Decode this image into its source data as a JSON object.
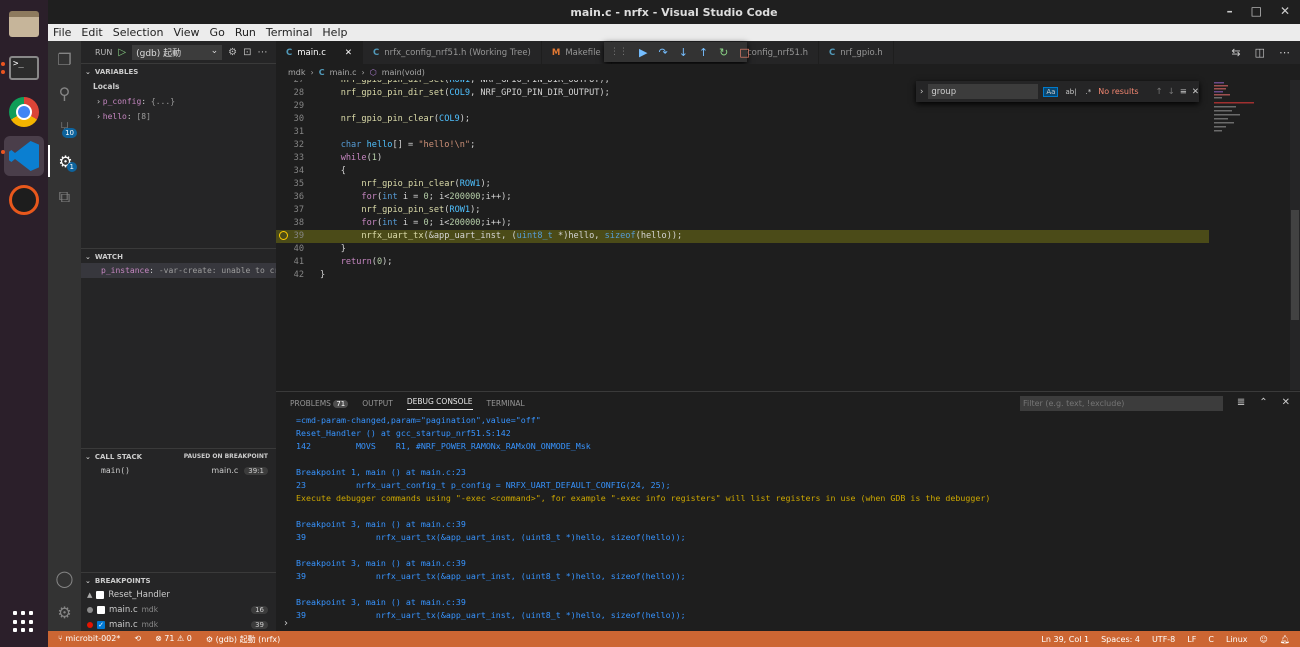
{
  "window": {
    "title": "main.c - nrfx - Visual Studio Code"
  },
  "menu": [
    "File",
    "Edit",
    "Selection",
    "View",
    "Go",
    "Run",
    "Terminal",
    "Help"
  ],
  "dock": {
    "term_glyph": ">_"
  },
  "activity_badges": {
    "scm": "10",
    "debug": "1"
  },
  "sidebar": {
    "run_label": "RUN",
    "config": "(gdb) 起動",
    "variables_title": "VARIABLES",
    "locals_label": "Locals",
    "variables": [
      {
        "name": "p_config",
        "value": "{...}"
      },
      {
        "name": "hello",
        "value": "[8]"
      }
    ],
    "watch_title": "WATCH",
    "watch": [
      {
        "name": "p_instance",
        "value": "-var-create: unable to cre..."
      }
    ],
    "callstack_title": "CALL STACK",
    "callstack_status": "PAUSED ON BREAKPOINT",
    "callstack": [
      {
        "name": "main()",
        "file": "main.c",
        "pos": "39:1"
      }
    ],
    "breakpoints_title": "BREAKPOINTS",
    "breakpoints": [
      {
        "name": "Reset_Handler",
        "folder": "",
        "line": ""
      },
      {
        "name": "main.c",
        "folder": "mdk",
        "line": "16"
      },
      {
        "name": "main.c",
        "folder": "mdk",
        "line": "39"
      }
    ]
  },
  "tabs": [
    {
      "icon": "C",
      "label": "main.c"
    },
    {
      "icon": "C",
      "label": "nrfx_config_nrf51.h (Working Tree)"
    },
    {
      "icon": "M",
      "label": "Makefile"
    },
    {
      "icon": "",
      "label": "x_config_nrf51.h"
    },
    {
      "icon": "C",
      "label": "nrf_gpio.h"
    }
  ],
  "breadcrumb": {
    "folder": "mdk",
    "file": "main.c",
    "symbol": "main(void)"
  },
  "find": {
    "value": "group",
    "case_opt": "Aa",
    "word_opt": "ab|",
    "regex_opt": ".*",
    "status": "No results"
  },
  "code": {
    "lines": [
      "27",
      "28",
      "29",
      "30",
      "31",
      "32",
      "33",
      "34",
      "35",
      "36",
      "37",
      "38",
      "39",
      "40",
      "41",
      "42"
    ]
  },
  "panel": {
    "tabs": [
      "PROBLEMS",
      "OUTPUT",
      "DEBUG CONSOLE",
      "TERMINAL"
    ],
    "problems_count": "71",
    "filter_placeholder": "Filter (e.g. text, !exclude)",
    "console": [
      {
        "text": "=cmd-param-changed,param=\"pagination\",value=\"off\"",
        "color": "blue"
      },
      {
        "text": "Reset_Handler () at gcc_startup_nrf51.S:142",
        "color": "blue"
      },
      {
        "text": "142         MOVS    R1, #NRF_POWER_RAMONx_RAMxON_ONMODE_Msk",
        "color": "blue"
      },
      {
        "text": "",
        "color": "blue"
      },
      {
        "text": "Breakpoint 1, main () at main.c:23",
        "color": "blue"
      },
      {
        "text": "23          nrfx_uart_config_t p_config = NRFX_UART_DEFAULT_CONFIG(24, 25);",
        "color": "blue"
      },
      {
        "text": "Execute debugger commands using \"-exec <command>\", for example \"-exec info registers\" will list registers in use (when GDB is the debugger)",
        "color": "orange"
      },
      {
        "text": "",
        "color": "blue"
      },
      {
        "text": "Breakpoint 3, main () at main.c:39",
        "color": "blue"
      },
      {
        "text": "39              nrfx_uart_tx(&app_uart_inst, (uint8_t *)hello, sizeof(hello));",
        "color": "blue"
      },
      {
        "text": "",
        "color": "blue"
      },
      {
        "text": "Breakpoint 3, main () at main.c:39",
        "color": "blue"
      },
      {
        "text": "39              nrfx_uart_tx(&app_uart_inst, (uint8_t *)hello, sizeof(hello));",
        "color": "blue"
      },
      {
        "text": "",
        "color": "blue"
      },
      {
        "text": "Breakpoint 3, main () at main.c:39",
        "color": "blue"
      },
      {
        "text": "39              nrfx_uart_tx(&app_uart_inst, (uint8_t *)hello, sizeof(hello));",
        "color": "blue"
      }
    ]
  },
  "status": {
    "branch": "microbit-002*",
    "problems": "⊗ 71 ⚠ 0",
    "debug": "(gdb) 起動 (nrfx)",
    "position": "Ln 39, Col 1",
    "spaces": "Spaces: 4",
    "encoding": "UTF-8",
    "eol": "LF",
    "language": "C",
    "os": "Linux"
  },
  "colors": {
    "status_bar": "#cc6633",
    "accent": "#007acc",
    "highlight_line": "#4b4b18"
  }
}
